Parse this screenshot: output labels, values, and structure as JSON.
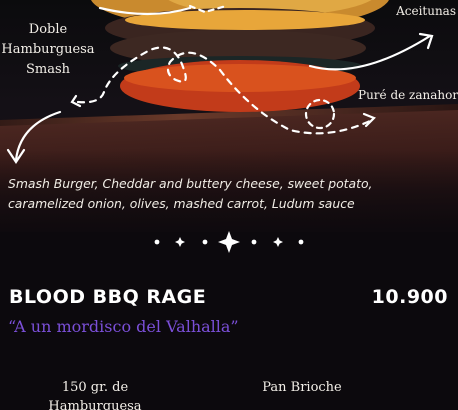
{
  "hero": {
    "callout_left": [
      "Doble",
      "Hamburguesa",
      "Smash"
    ],
    "callout_right_top": "Aceitunas",
    "callout_right": "Puré de zanahoria"
  },
  "description": {
    "line1": "Smash Burger, Cheddar and buttery cheese, sweet potato,",
    "line2": "caramelized onion, olives, mashed carrot, Ludum sauce"
  },
  "item": {
    "name": "BLOOD BBQ RAGE",
    "price": "10.900",
    "tagline": "“A un mordisco del Valhalla”"
  },
  "ingredients": {
    "left": [
      "150 gr. de",
      "Hamburguesa"
    ],
    "right": [
      "Pan Brioche"
    ]
  },
  "colors": {
    "background": "#0c090d",
    "accent_purple": "#7b4fd8",
    "text_light": "#f3efe8"
  }
}
